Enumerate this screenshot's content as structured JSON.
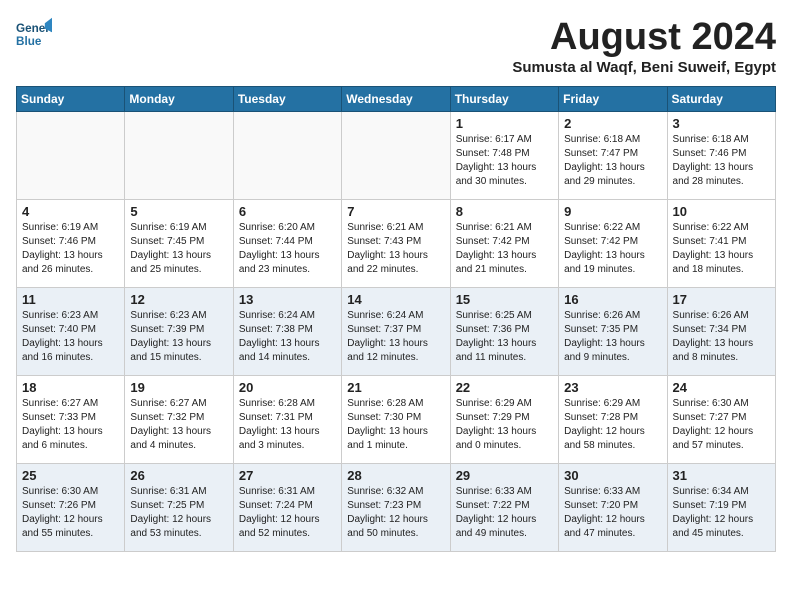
{
  "header": {
    "logo_line1": "General",
    "logo_line2": "Blue",
    "month": "August 2024",
    "location": "Sumusta al Waqf, Beni Suweif, Egypt"
  },
  "weekdays": [
    "Sunday",
    "Monday",
    "Tuesday",
    "Wednesday",
    "Thursday",
    "Friday",
    "Saturday"
  ],
  "weeks": [
    [
      {
        "day": "",
        "text": "",
        "empty": true
      },
      {
        "day": "",
        "text": "",
        "empty": true
      },
      {
        "day": "",
        "text": "",
        "empty": true
      },
      {
        "day": "",
        "text": "",
        "empty": true
      },
      {
        "day": "1",
        "text": "Sunrise: 6:17 AM\nSunset: 7:48 PM\nDaylight: 13 hours\nand 30 minutes.",
        "empty": false
      },
      {
        "day": "2",
        "text": "Sunrise: 6:18 AM\nSunset: 7:47 PM\nDaylight: 13 hours\nand 29 minutes.",
        "empty": false
      },
      {
        "day": "3",
        "text": "Sunrise: 6:18 AM\nSunset: 7:46 PM\nDaylight: 13 hours\nand 28 minutes.",
        "empty": false
      }
    ],
    [
      {
        "day": "4",
        "text": "Sunrise: 6:19 AM\nSunset: 7:46 PM\nDaylight: 13 hours\nand 26 minutes.",
        "empty": false
      },
      {
        "day": "5",
        "text": "Sunrise: 6:19 AM\nSunset: 7:45 PM\nDaylight: 13 hours\nand 25 minutes.",
        "empty": false
      },
      {
        "day": "6",
        "text": "Sunrise: 6:20 AM\nSunset: 7:44 PM\nDaylight: 13 hours\nand 23 minutes.",
        "empty": false
      },
      {
        "day": "7",
        "text": "Sunrise: 6:21 AM\nSunset: 7:43 PM\nDaylight: 13 hours\nand 22 minutes.",
        "empty": false
      },
      {
        "day": "8",
        "text": "Sunrise: 6:21 AM\nSunset: 7:42 PM\nDaylight: 13 hours\nand 21 minutes.",
        "empty": false
      },
      {
        "day": "9",
        "text": "Sunrise: 6:22 AM\nSunset: 7:42 PM\nDaylight: 13 hours\nand 19 minutes.",
        "empty": false
      },
      {
        "day": "10",
        "text": "Sunrise: 6:22 AM\nSunset: 7:41 PM\nDaylight: 13 hours\nand 18 minutes.",
        "empty": false
      }
    ],
    [
      {
        "day": "11",
        "text": "Sunrise: 6:23 AM\nSunset: 7:40 PM\nDaylight: 13 hours\nand 16 minutes.",
        "empty": false
      },
      {
        "day": "12",
        "text": "Sunrise: 6:23 AM\nSunset: 7:39 PM\nDaylight: 13 hours\nand 15 minutes.",
        "empty": false
      },
      {
        "day": "13",
        "text": "Sunrise: 6:24 AM\nSunset: 7:38 PM\nDaylight: 13 hours\nand 14 minutes.",
        "empty": false
      },
      {
        "day": "14",
        "text": "Sunrise: 6:24 AM\nSunset: 7:37 PM\nDaylight: 13 hours\nand 12 minutes.",
        "empty": false
      },
      {
        "day": "15",
        "text": "Sunrise: 6:25 AM\nSunset: 7:36 PM\nDaylight: 13 hours\nand 11 minutes.",
        "empty": false
      },
      {
        "day": "16",
        "text": "Sunrise: 6:26 AM\nSunset: 7:35 PM\nDaylight: 13 hours\nand 9 minutes.",
        "empty": false
      },
      {
        "day": "17",
        "text": "Sunrise: 6:26 AM\nSunset: 7:34 PM\nDaylight: 13 hours\nand 8 minutes.",
        "empty": false
      }
    ],
    [
      {
        "day": "18",
        "text": "Sunrise: 6:27 AM\nSunset: 7:33 PM\nDaylight: 13 hours\nand 6 minutes.",
        "empty": false
      },
      {
        "day": "19",
        "text": "Sunrise: 6:27 AM\nSunset: 7:32 PM\nDaylight: 13 hours\nand 4 minutes.",
        "empty": false
      },
      {
        "day": "20",
        "text": "Sunrise: 6:28 AM\nSunset: 7:31 PM\nDaylight: 13 hours\nand 3 minutes.",
        "empty": false
      },
      {
        "day": "21",
        "text": "Sunrise: 6:28 AM\nSunset: 7:30 PM\nDaylight: 13 hours\nand 1 minute.",
        "empty": false
      },
      {
        "day": "22",
        "text": "Sunrise: 6:29 AM\nSunset: 7:29 PM\nDaylight: 13 hours\nand 0 minutes.",
        "empty": false
      },
      {
        "day": "23",
        "text": "Sunrise: 6:29 AM\nSunset: 7:28 PM\nDaylight: 12 hours\nand 58 minutes.",
        "empty": false
      },
      {
        "day": "24",
        "text": "Sunrise: 6:30 AM\nSunset: 7:27 PM\nDaylight: 12 hours\nand 57 minutes.",
        "empty": false
      }
    ],
    [
      {
        "day": "25",
        "text": "Sunrise: 6:30 AM\nSunset: 7:26 PM\nDaylight: 12 hours\nand 55 minutes.",
        "empty": false
      },
      {
        "day": "26",
        "text": "Sunrise: 6:31 AM\nSunset: 7:25 PM\nDaylight: 12 hours\nand 53 minutes.",
        "empty": false
      },
      {
        "day": "27",
        "text": "Sunrise: 6:31 AM\nSunset: 7:24 PM\nDaylight: 12 hours\nand 52 minutes.",
        "empty": false
      },
      {
        "day": "28",
        "text": "Sunrise: 6:32 AM\nSunset: 7:23 PM\nDaylight: 12 hours\nand 50 minutes.",
        "empty": false
      },
      {
        "day": "29",
        "text": "Sunrise: 6:33 AM\nSunset: 7:22 PM\nDaylight: 12 hours\nand 49 minutes.",
        "empty": false
      },
      {
        "day": "30",
        "text": "Sunrise: 6:33 AM\nSunset: 7:20 PM\nDaylight: 12 hours\nand 47 minutes.",
        "empty": false
      },
      {
        "day": "31",
        "text": "Sunrise: 6:34 AM\nSunset: 7:19 PM\nDaylight: 12 hours\nand 45 minutes.",
        "empty": false
      }
    ]
  ]
}
